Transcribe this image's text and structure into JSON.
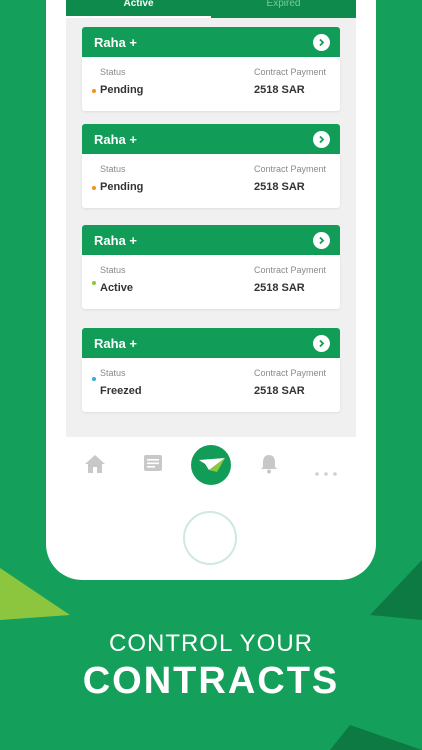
{
  "tabs": [
    {
      "label": "Active"
    },
    {
      "label": "Expired"
    }
  ],
  "contracts": [
    {
      "title": "Raha +",
      "status_label": "Status",
      "status": "Pending",
      "status_color": "#f0941e",
      "payment_label": "Contract Payment",
      "payment": "2518 SAR"
    },
    {
      "title": "Raha +",
      "status_label": "Status",
      "status": "Pending",
      "status_color": "#f0941e",
      "payment_label": "Contract Payment",
      "payment": "2518 SAR"
    },
    {
      "title": "Raha +",
      "status_label": "Status",
      "status": "Active",
      "status_color": "#8dc63f",
      "payment_label": "Contract Payment",
      "payment": "2518 SAR"
    },
    {
      "title": "Raha +",
      "status_label": "Status",
      "status": "Freezed",
      "status_color": "#3aa8d8",
      "payment_label": "Contract Payment",
      "payment": "2518 SAR"
    }
  ],
  "bottom_nav": {
    "icons": [
      "home-icon",
      "document-icon",
      "send-icon",
      "bell-icon",
      "more-icon"
    ],
    "accent": "#119c57",
    "icon_color": "#c8c8c8"
  },
  "headline": {
    "line1": "CONTROL YOUR",
    "line2": "CONTRACTS"
  },
  "colors": {
    "brand_green": "#14a05a",
    "header_green": "#119c57",
    "tab_green": "#0e8a4c"
  }
}
